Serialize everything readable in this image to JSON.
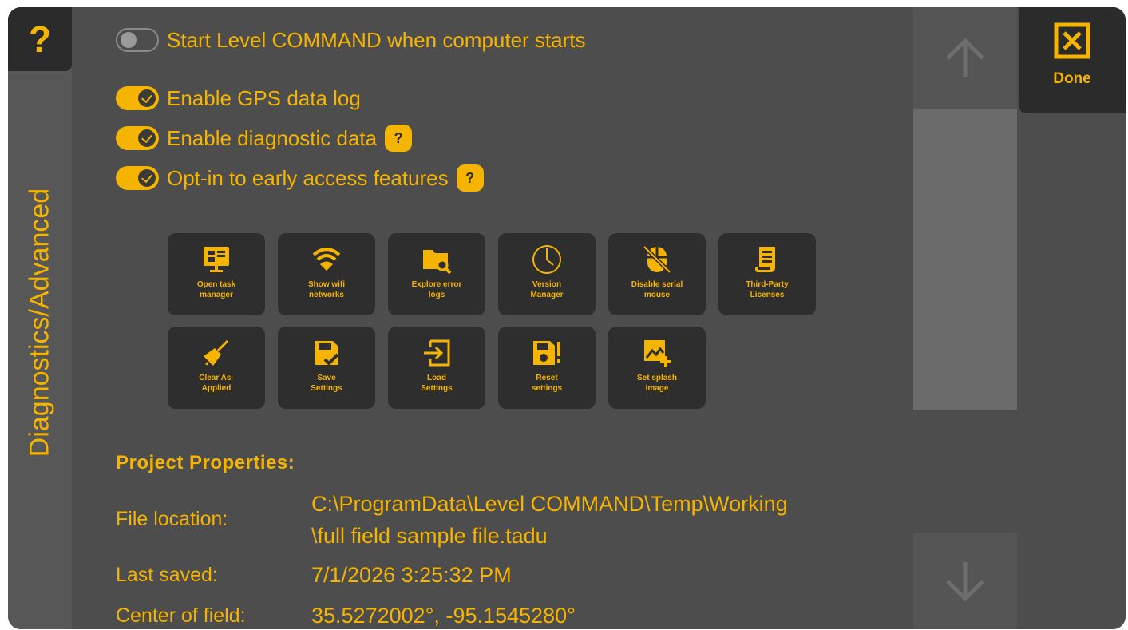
{
  "sidebar": {
    "help_label": "?",
    "title": "Diagnostics/Advanced"
  },
  "settings": {
    "toggles": [
      {
        "label": "Start Level COMMAND when computer starts",
        "state": "off"
      },
      {
        "label": "Enable GPS data log",
        "state": "on"
      },
      {
        "label": "Enable diagnostic data",
        "state": "on",
        "help": "?"
      },
      {
        "label": "Opt-in to early access features",
        "state": "on",
        "help": "?"
      }
    ]
  },
  "tiles": [
    {
      "label": "Open task\nmanager",
      "icon": "monitor-icon"
    },
    {
      "label": "Show wifi\nnetworks",
      "icon": "wifi-icon"
    },
    {
      "label": "Explore error\nlogs",
      "icon": "folder-search-icon"
    },
    {
      "label": "Version\nManager",
      "icon": "clock-icon"
    },
    {
      "label": "Disable serial\nmouse",
      "icon": "mouse-off-icon"
    },
    {
      "label": "Third-Party\nLicenses",
      "icon": "document-icon"
    },
    {
      "label": "Clear As-\nApplied",
      "icon": "broom-icon"
    },
    {
      "label": "Save\nSettings",
      "icon": "save-check-icon"
    },
    {
      "label": "Load\nSettings",
      "icon": "load-arrow-icon"
    },
    {
      "label": "Reset\nsettings",
      "icon": "save-alert-icon"
    },
    {
      "label": "Set splash\nimage",
      "icon": "image-add-icon"
    }
  ],
  "project": {
    "heading": "Project Properties:",
    "file_location_label": "File location:",
    "file_location_line1": "C:\\ProgramData\\Level COMMAND\\Temp\\Working",
    "file_location_line2": "\\full field sample file.tadu",
    "last_saved_label": "Last saved:",
    "last_saved_value": "7/1/2026 3:25:32 PM",
    "center_label": "Center of field:",
    "center_value": "35.5272002°, -95.1545280°"
  },
  "done": {
    "label": "Done"
  },
  "colors": {
    "accent": "#f5b400",
    "panel": "#4d4d4d",
    "tile": "#2e2e2e"
  }
}
